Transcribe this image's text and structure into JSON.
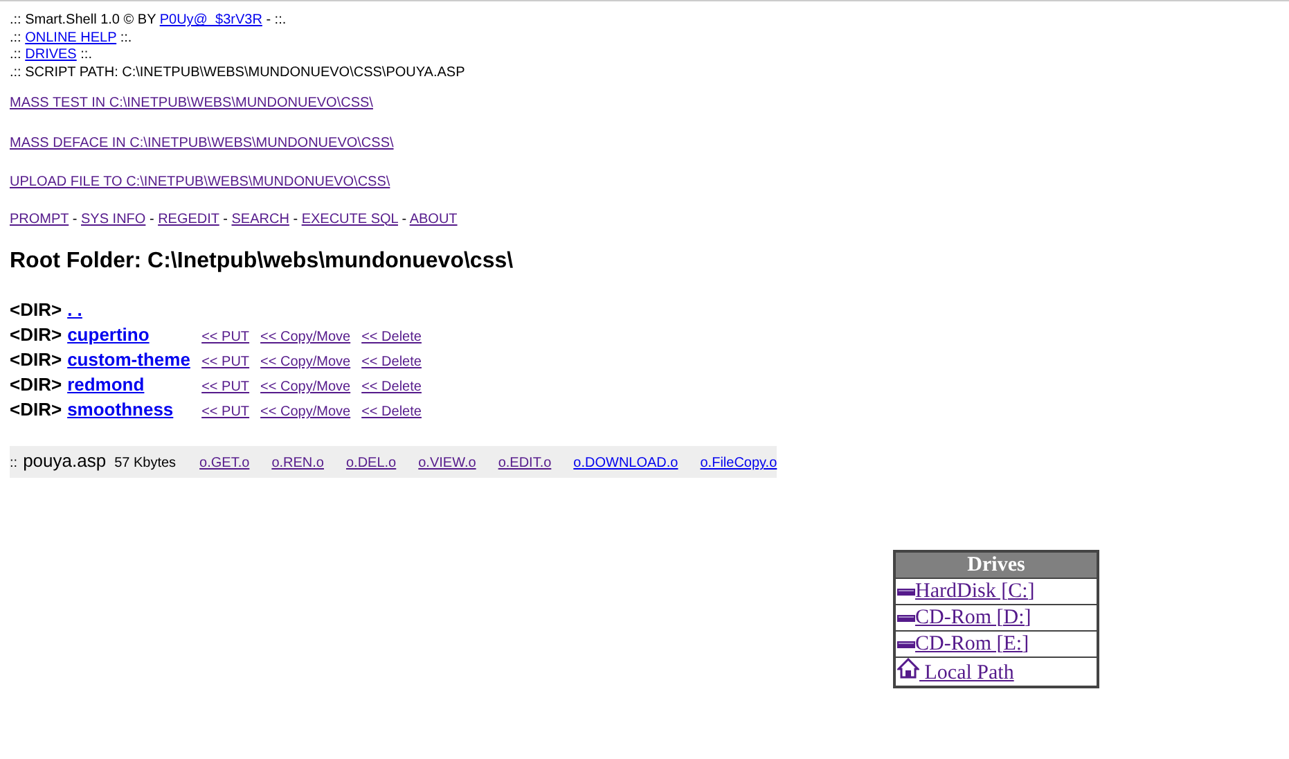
{
  "header": {
    "title_prefix": ".:: Smart.Shell 1.0 © BY",
    "author_link": {
      "text": "P0Uy@_$3rV3R",
      "visited": false
    },
    "title_suffix": "- ::.",
    "lines": [
      {
        "prefix": ".::",
        "link": {
          "text": "ONLINE HELP",
          "visited": false
        },
        "suffix": "::."
      },
      {
        "prefix": ".::",
        "link": {
          "text": "DRIVES",
          "visited": false
        },
        "suffix": "::."
      }
    ],
    "script_path": ".:: SCRIPT PATH: C:\\INETPUB\\WEBS\\MUNDONUEVO\\CSS\\POUYA.ASP"
  },
  "mass_links": [
    {
      "text": "MASS TEST IN C:\\INETPUB\\WEBS\\MUNDONUEVO\\CSS\\",
      "visited": true
    },
    {
      "text": "MASS DEFACE IN C:\\INETPUB\\WEBS\\MUNDONUEVO\\CSS\\",
      "visited": true
    },
    {
      "text": "UPLOAD FILE TO C:\\INETPUB\\WEBS\\MUNDONUEVO\\CSS\\",
      "visited": true
    }
  ],
  "menu": {
    "separator": "-",
    "items": [
      {
        "text": "PROMPT",
        "visited": true
      },
      {
        "text": "SYS INFO",
        "visited": true
      },
      {
        "text": "REGEDIT",
        "visited": true
      },
      {
        "text": "SEARCH",
        "visited": true
      },
      {
        "text": "EXECUTE SQL",
        "visited": true
      },
      {
        "text": "ABOUT",
        "visited": true
      }
    ]
  },
  "root_folder": "Root Folder: C:\\Inetpub\\webs\\mundonuevo\\css\\",
  "dirs": [
    {
      "tag": "<DIR>",
      "name": {
        "text": ". .",
        "visited": false
      }
    },
    {
      "tag": "<DIR>",
      "name": {
        "text": "cupertino",
        "visited": false
      },
      "actions": [
        {
          "text": "<< PUT",
          "visited": true
        },
        {
          "text": "<< Copy/Move",
          "visited": true
        },
        {
          "text": "<< Delete",
          "visited": true
        }
      ]
    },
    {
      "tag": "<DIR>",
      "name": {
        "text": "custom-theme",
        "visited": false
      },
      "actions": [
        {
          "text": "<< PUT",
          "visited": true
        },
        {
          "text": "<< Copy/Move",
          "visited": true
        },
        {
          "text": "<< Delete",
          "visited": true
        }
      ]
    },
    {
      "tag": "<DIR>",
      "name": {
        "text": "redmond",
        "visited": false
      },
      "actions": [
        {
          "text": "<< PUT",
          "visited": true
        },
        {
          "text": "<< Copy/Move",
          "visited": true
        },
        {
          "text": "<< Delete",
          "visited": true
        }
      ]
    },
    {
      "tag": "<DIR>",
      "name": {
        "text": "smoothness",
        "visited": false
      },
      "actions": [
        {
          "text": "<< PUT",
          "visited": true
        },
        {
          "text": "<< Copy/Move",
          "visited": true
        },
        {
          "text": "<< Delete",
          "visited": true
        }
      ]
    }
  ],
  "files": [
    {
      "prefix": "::",
      "name": "pouya.asp",
      "size": "57 Kbytes",
      "actions": [
        {
          "text": "o.GET.o",
          "visited": true
        },
        {
          "text": "o.REN.o",
          "visited": true
        },
        {
          "text": "o.DEL.o",
          "visited": true
        },
        {
          "text": "o.VIEW.o",
          "visited": true
        },
        {
          "text": "o.EDIT.o",
          "visited": true
        },
        {
          "text": "o.DOWNLOAD.o",
          "visited": false
        },
        {
          "text": "o.FileCopy.o",
          "visited": false
        }
      ]
    }
  ],
  "drives": {
    "title": "Drives",
    "items": [
      {
        "kind": "disk",
        "text": "HardDisk [C:]",
        "visited": true
      },
      {
        "kind": "disk",
        "text": "CD-Rom [D:]",
        "visited": true
      },
      {
        "kind": "disk",
        "text": "CD-Rom [E:]",
        "visited": true
      },
      {
        "kind": "home",
        "text": " Local Path",
        "visited": true
      }
    ]
  }
}
